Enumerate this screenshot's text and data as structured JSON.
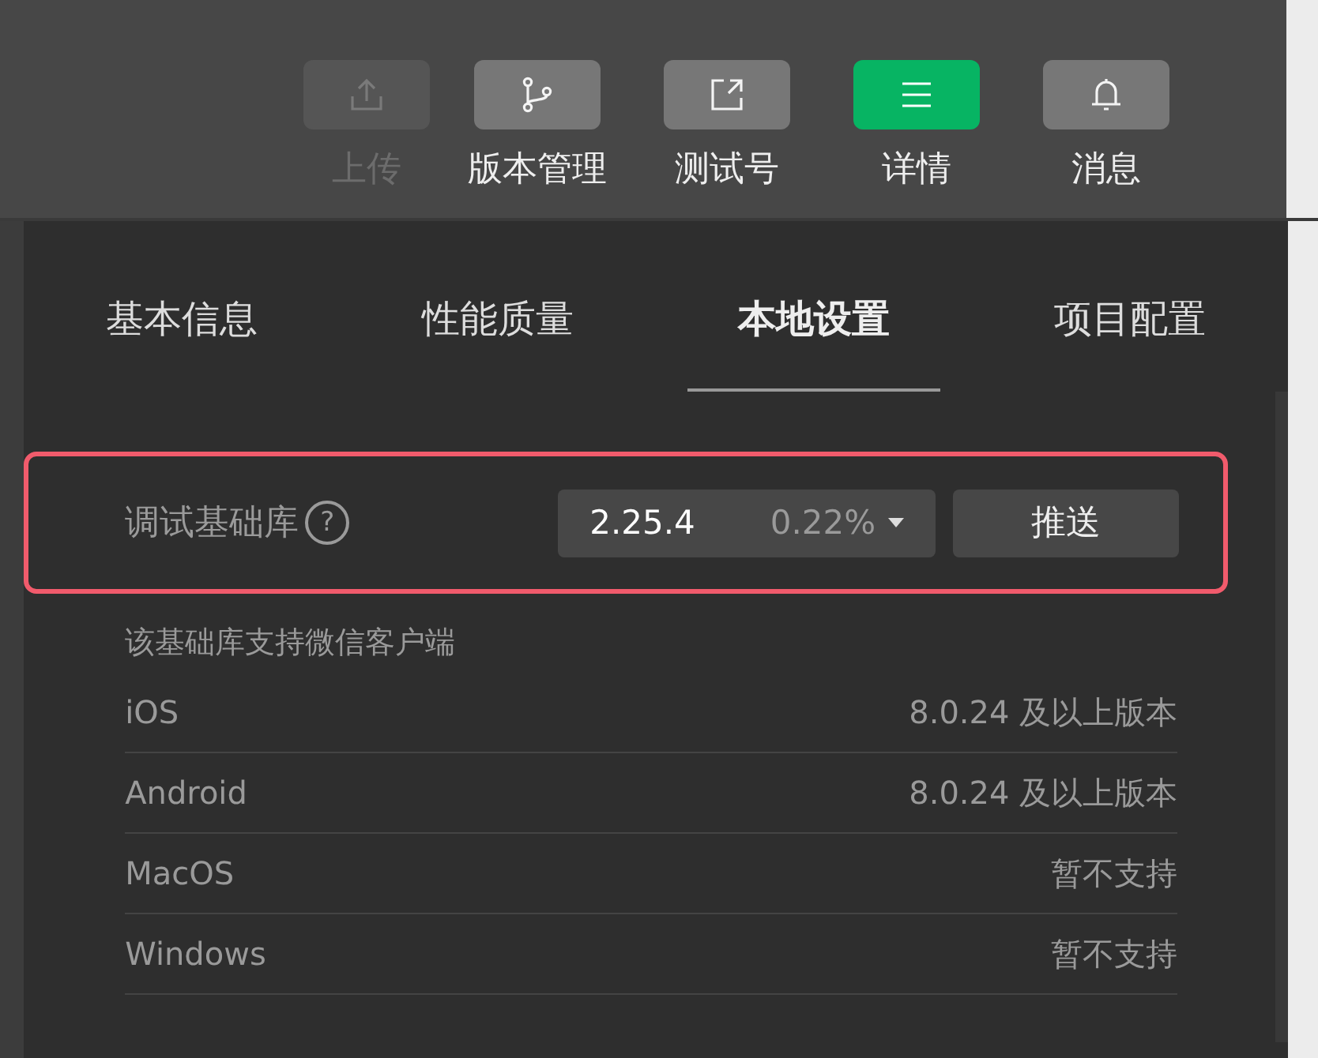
{
  "toolbar": [
    {
      "kind": "upload",
      "label": "上传",
      "disabled": true,
      "selected": false
    },
    {
      "kind": "branch",
      "label": "版本管理",
      "disabled": false,
      "selected": false
    },
    {
      "kind": "share",
      "label": "测试号",
      "disabled": false,
      "selected": false
    },
    {
      "kind": "menu",
      "label": "详情",
      "disabled": false,
      "selected": true
    },
    {
      "kind": "bell",
      "label": "消息",
      "disabled": false,
      "selected": false
    }
  ],
  "tabs": [
    {
      "label": "基本信息",
      "selected": false
    },
    {
      "label": "性能质量",
      "selected": false
    },
    {
      "label": "本地设置",
      "selected": true
    },
    {
      "label": "项目配置",
      "selected": false
    }
  ],
  "library": {
    "label": "调试基础库",
    "help": "?",
    "version": "2.25.4",
    "share": "0.22%",
    "push_button": "推送"
  },
  "support": {
    "title": "该基础库支持微信客户端",
    "rows": [
      {
        "platform": "iOS",
        "requirement": "8.0.24 及以上版本"
      },
      {
        "platform": "Android",
        "requirement": "8.0.24 及以上版本"
      },
      {
        "platform": "MacOS",
        "requirement": "暂不支持"
      },
      {
        "platform": "Windows",
        "requirement": "暂不支持"
      }
    ]
  }
}
